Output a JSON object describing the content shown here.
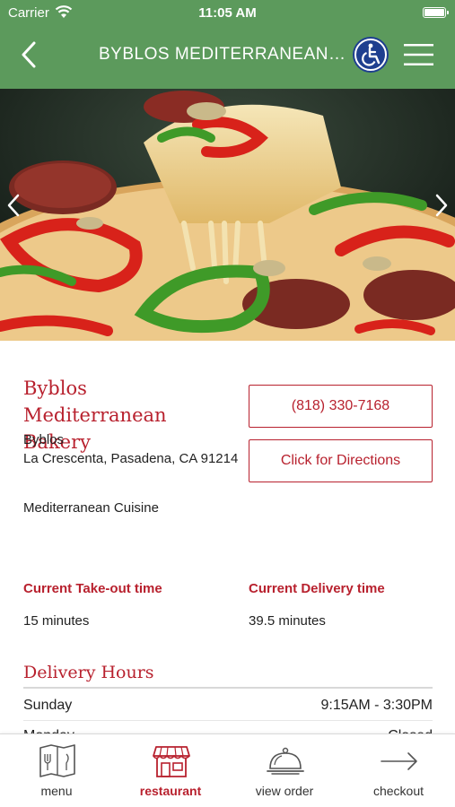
{
  "status_bar": {
    "carrier": "Carrier",
    "time": "11:05 AM"
  },
  "nav": {
    "title": "BYBLOS MEDITERRANEAN BAKERY",
    "back_icon": "chevron-left-icon",
    "accessibility_icon": "wheelchair-icon",
    "menu_icon": "hamburger-icon"
  },
  "hero": {
    "image": "pizza-photo",
    "prev_icon": "chevron-left-icon",
    "next_icon": "chevron-right-icon"
  },
  "restaurant": {
    "name": "Byblos Mediterranean Bakery",
    "address_line1": "Byblos",
    "address_line2": "La Crescenta, Pasadena, CA 91214",
    "cuisine": "Mediterranean Cuisine",
    "phone": "(818) 330-7168",
    "directions_label": "Click for Directions"
  },
  "times": {
    "takeout_label": "Current Take-out time",
    "takeout_value": "15 minutes",
    "delivery_label": "Current Delivery time",
    "delivery_value": "39.5 minutes"
  },
  "delivery_hours": {
    "title": "Delivery Hours",
    "rows": [
      {
        "day": "Sunday",
        "hours": "9:15AM - 3:30PM"
      },
      {
        "day": "Monday",
        "hours": "Closed"
      }
    ]
  },
  "tabs": [
    {
      "label": "menu",
      "icon": "menu-book-icon",
      "active": false
    },
    {
      "label": "restaurant",
      "icon": "storefront-icon",
      "active": true
    },
    {
      "label": "view order",
      "icon": "cloche-icon",
      "active": false
    },
    {
      "label": "checkout",
      "icon": "arrow-right-icon",
      "active": false
    }
  ],
  "colors": {
    "header_green": "#5c9a5c",
    "accent_red": "#b8212e"
  }
}
